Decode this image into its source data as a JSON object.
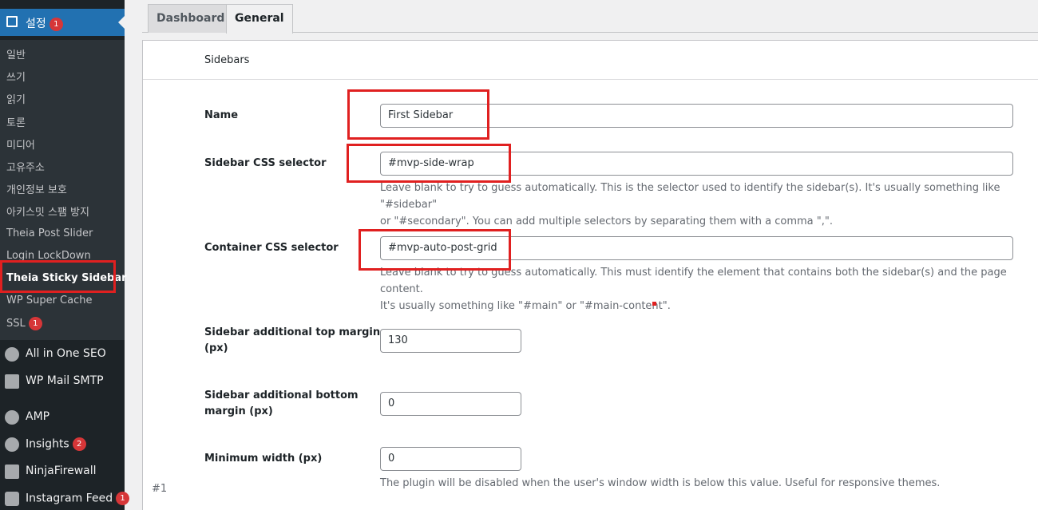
{
  "sidebar": {
    "current_menu": {
      "label": "설정",
      "badge": "1"
    },
    "submenu": [
      {
        "label": "일반"
      },
      {
        "label": "쓰기"
      },
      {
        "label": "읽기"
      },
      {
        "label": "토론"
      },
      {
        "label": "미디어"
      },
      {
        "label": "고유주소"
      },
      {
        "label": "개인정보 보호"
      },
      {
        "label": "아키스밋 스팸 방지"
      },
      {
        "label": "Theia Post Slider"
      },
      {
        "label": "Login LockDown"
      },
      {
        "label": "Theia Sticky Sidebar"
      },
      {
        "label": "WP Super Cache"
      },
      {
        "label": "SSL",
        "badge": "1"
      }
    ],
    "menu": [
      {
        "label": "All in One SEO"
      },
      {
        "label": "WP Mail SMTP"
      },
      {
        "label": "AMP"
      },
      {
        "label": "Insights",
        "badge": "2"
      },
      {
        "label": "NinjaFirewall"
      },
      {
        "label": "Instagram Feed",
        "badge": "1"
      }
    ]
  },
  "tabs": [
    {
      "label": "Dashboard"
    },
    {
      "label": "General"
    }
  ],
  "panel": {
    "section_title": "Sidebars",
    "index_note": "#1",
    "fields": {
      "name": {
        "label": "Name",
        "value": "First Sidebar"
      },
      "sidebar_selector": {
        "label": "Sidebar CSS selector",
        "value": "#mvp-side-wrap",
        "help_1": "Leave blank to try to guess automatically. This is the selector used to identify the sidebar(s). It's usually something like \"#sidebar\"",
        "help_2": "or \"#secondary\". You can add multiple selectors by separating them with a comma \",\"."
      },
      "container_selector": {
        "label": "Container CSS selector",
        "value": "#mvp-auto-post-grid",
        "help_1": "Leave blank to try to guess automatically. This must identify the element that contains both the sidebar(s) and the page content.",
        "help_2": "It's usually something like \"#main\" or \"#main-content\"."
      },
      "top_margin": {
        "label_1": "Sidebar additional top margin",
        "label_2": "(px)",
        "value": "130"
      },
      "bottom_margin": {
        "label_1": "Sidebar additional bottom",
        "label_2": "margin (px)",
        "value": "0"
      },
      "min_width": {
        "label": "Minimum width (px)",
        "value": "0",
        "help": "The plugin will be disabled when the user's window width is below this value. Useful for responsive themes."
      }
    }
  },
  "colors": {
    "sidebar_bg": "#1d2327",
    "submenu_bg": "#2c3338",
    "accent": "#2271b1",
    "badge": "#d63638",
    "annotation_red": "#e02020"
  }
}
